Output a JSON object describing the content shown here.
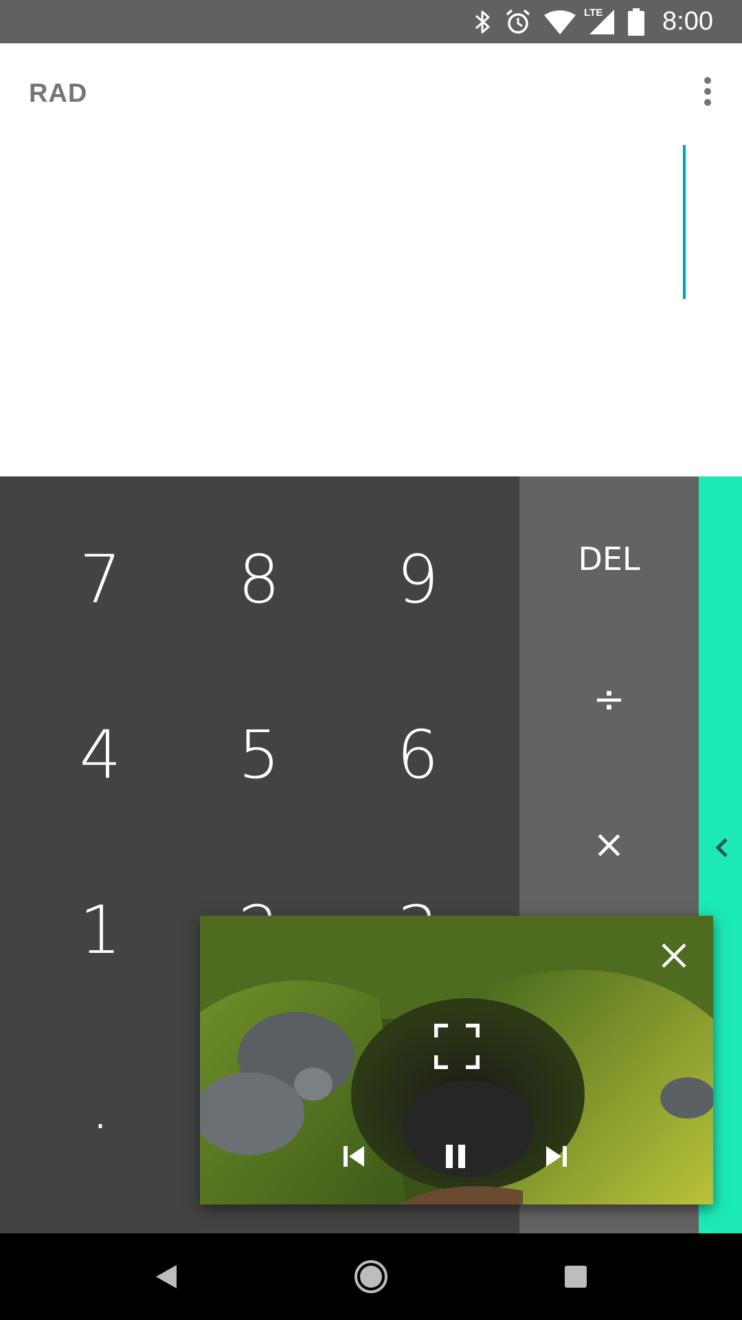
{
  "status_bar": {
    "time": "8:00",
    "network_label": "LTE",
    "icons": [
      "bluetooth-icon",
      "alarm-icon",
      "wifi-icon",
      "lte-signal-icon",
      "battery-icon"
    ]
  },
  "display": {
    "angle_mode": "RAD",
    "menu_icon": "more-vert-icon",
    "cursor_color": "#00a3a6"
  },
  "keypad": {
    "digits": [
      "7",
      "8",
      "9",
      "4",
      "5",
      "6",
      "1",
      "2",
      "3",
      "."
    ],
    "operators": {
      "delete": "DEL",
      "divide": "÷",
      "multiply": "×"
    },
    "advanced_panel_icon": "chevron-left-icon",
    "colors": {
      "numpad_bg": "#434343",
      "operator_bg": "#636363",
      "advanced_bg": "#1de9b6"
    }
  },
  "pip_player": {
    "controls": [
      "close-icon",
      "fullscreen-icon",
      "skip-previous-icon",
      "pause-icon",
      "skip-next-icon"
    ]
  },
  "nav_bar": {
    "buttons": [
      "back-icon",
      "home-icon",
      "recents-icon"
    ]
  }
}
